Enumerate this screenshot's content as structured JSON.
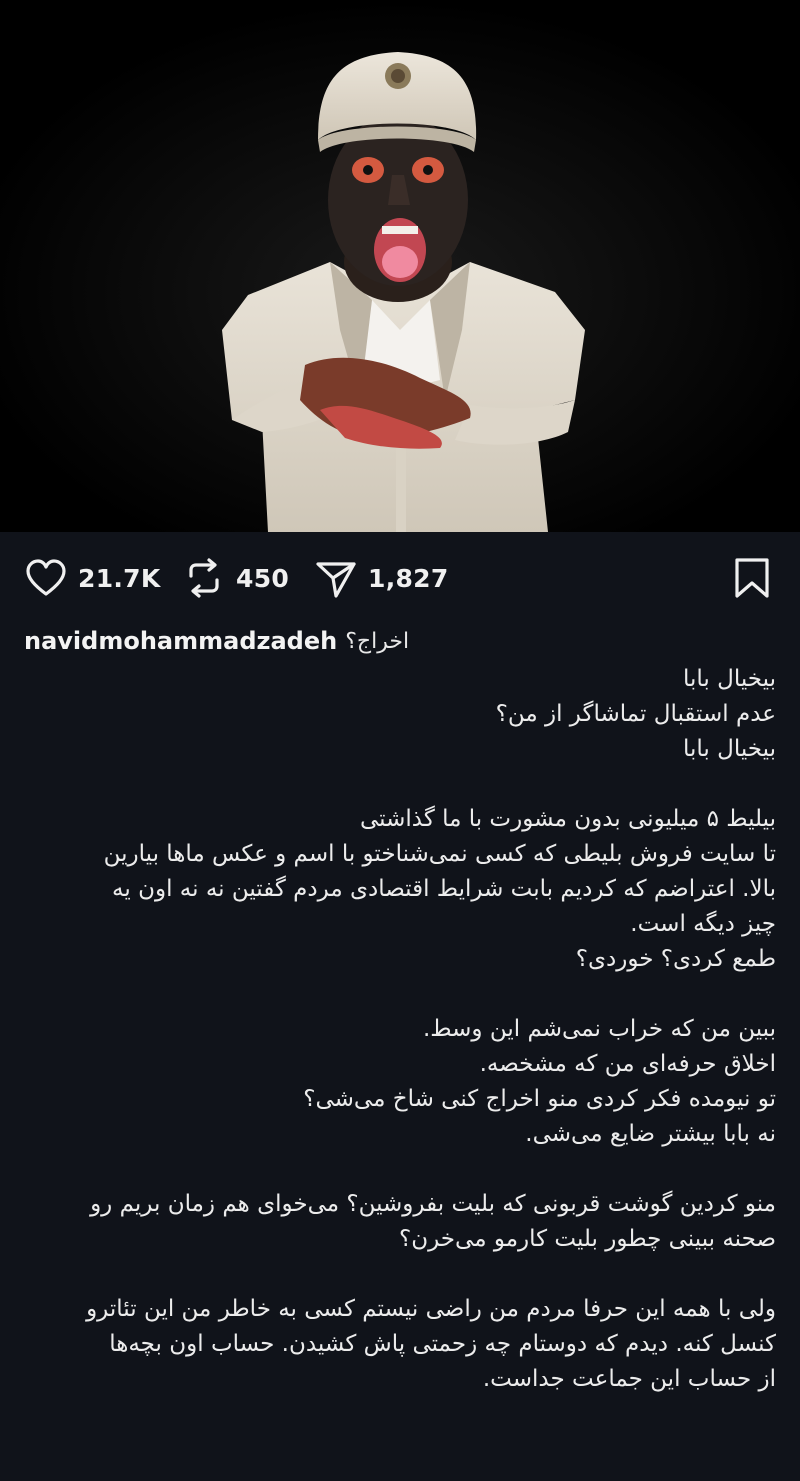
{
  "post": {
    "likes": "21.7K",
    "reposts": "450",
    "shares": "1,827"
  },
  "author": {
    "username": "navidmohammadzadeh",
    "caption_first": "اخراج؟"
  },
  "caption_lines": [
    "بیخیال بابا",
    "عدم استقبال تماشاگر از من؟",
    "بیخیال بابا",
    "",
    "بیلیط ۵ میلیونی بدون مشورت با ما گذاشتی",
    "تا سایت فروش بلیطی که کسی نمی‌شناختو با اسم و عکس ماها بیارین",
    "بالا. اعتراضم که کردیم بابت شرایط اقتصادی مردم گفتین نه نه اون یه",
    "چیز دیگه است.",
    "طمع کردی؟ خوردی؟",
    "",
    "ببین من که خراب نمی‌شم این وسط.",
    "اخلاق حرفه‌ای من که مشخصه.",
    "تو نیومده فکر کردی منو اخراج کنی شاخ می‌شی؟",
    "نه بابا بیشتر ضایع می‌شی.",
    "",
    "منو کردین گوشت قربونی که بلیت بفروشین؟ می‌خوای هم زمان بریم رو",
    "صحنه ببینی چطور بلیت کارمو می‌خرن؟",
    "",
    "ولی با همه این حرفا مردم من راضی نیستم کسی به خاطر من این تئاترو",
    "کنسل کنه. دیدم که دوستام چه زحمتی پاش کشیدن. حساب اون بچه‌ها",
    "از حساب این جماعت جداست."
  ],
  "icons": {
    "like": "heart-icon",
    "repost": "repost-icon",
    "share": "send-icon",
    "save": "bookmark-icon"
  }
}
